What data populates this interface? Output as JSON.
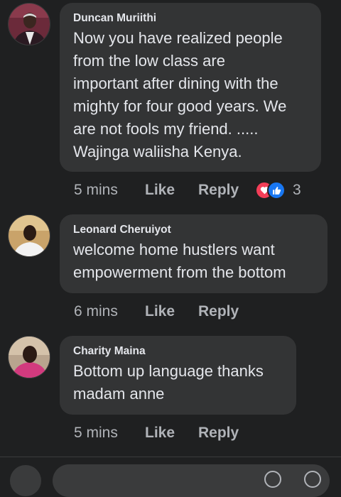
{
  "comments": [
    {
      "author": "Duncan Muriithi",
      "text": "Now you have realized people\nfrom the low class are\nimportant after dining with the\nmighty for four good years. We\nare not fools my friend. .....\nWajinga waliisha Kenya.",
      "time": "5 mins",
      "like_label": "Like",
      "reply_label": "Reply",
      "reaction_count": "3",
      "reactions": [
        "heart-icon",
        "thumbs-up-icon"
      ]
    },
    {
      "author": "Leonard Cheruiyot",
      "text": "welcome home hustlers want\nempowerment from the bottom",
      "time": "6 mins",
      "like_label": "Like",
      "reply_label": "Reply"
    },
    {
      "author": "Charity Maina",
      "text": "Bottom up language thanks\nmadam anne",
      "time": "5 mins",
      "like_label": "Like",
      "reply_label": "Reply"
    }
  ],
  "colors": {
    "background": "#1f2021",
    "bubble": "#333435",
    "text": "#e4e6eb",
    "muted": "#b0b3b8",
    "love": "#f33e58",
    "like": "#1877f2"
  }
}
